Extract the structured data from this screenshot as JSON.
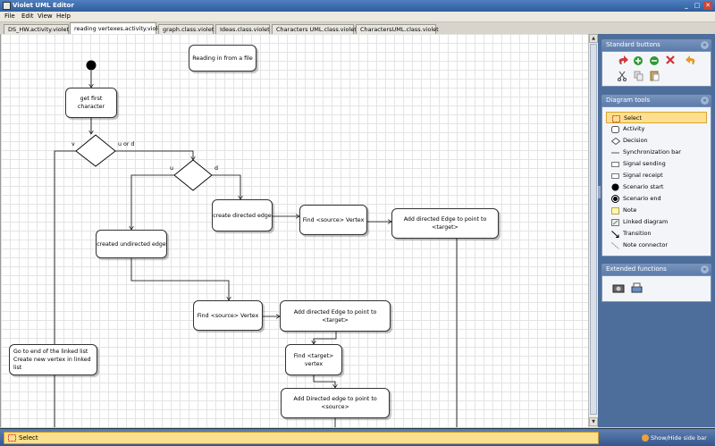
{
  "window": {
    "title": "Violet UML Editor",
    "controls": [
      "_",
      "□",
      "✕"
    ]
  },
  "menu": [
    "File",
    "Edit",
    "View",
    "Help"
  ],
  "tabs": [
    {
      "label": "DS_HW.activity.violet",
      "active": false
    },
    {
      "label": "reading vertexes.activity.violet",
      "active": true
    },
    {
      "label": "graph.class.violet",
      "active": false
    },
    {
      "label": "Ideas.class.violet",
      "active": false
    },
    {
      "label": "Characters UML.class.violet",
      "active": false
    },
    {
      "label": "CharactersUML.class.violet",
      "active": false
    }
  ],
  "diagram": {
    "nodes": [
      {
        "id": "n_reading",
        "text": "Reading in from a file"
      },
      {
        "id": "n_first",
        "text": "get first character"
      },
      {
        "id": "n_create_directed",
        "text": "create directed edge"
      },
      {
        "id": "n_find_src1",
        "text": "Find <source> Vertex"
      },
      {
        "id": "n_add_directed1",
        "text": "Add directed Edge to point to <target>"
      },
      {
        "id": "n_undirected",
        "text": "created undirected edge"
      },
      {
        "id": "n_find_src2",
        "text": "Find <source> Vertex"
      },
      {
        "id": "n_add_directed2",
        "text": "Add directed Edge to point to <target>"
      },
      {
        "id": "n_find_target",
        "text": "Find <target> vertex"
      },
      {
        "id": "n_add_directed3",
        "text": "Add Directed edge to point to <source>"
      },
      {
        "id": "n_goto_end",
        "text": "Go to end of the linked list\nCreate new vertex in linked list"
      }
    ],
    "edge_labels": {
      "v": "v",
      "u_or_d": "u or d",
      "u": "u",
      "d": "d"
    }
  },
  "sidebar": {
    "standard_buttons_title": "Standard buttons",
    "diagram_tools_title": "Diagram tools",
    "tools": [
      {
        "label": "Select",
        "icon": "select-icon",
        "selected": true
      },
      {
        "label": "Activity",
        "icon": "activity-icon",
        "selected": false
      },
      {
        "label": "Decision",
        "icon": "decision-icon",
        "selected": false
      },
      {
        "label": "Synchronization bar",
        "icon": "sync-bar-icon",
        "selected": false
      },
      {
        "label": "Signal sending",
        "icon": "signal-sending-icon",
        "selected": false
      },
      {
        "label": "Signal receipt",
        "icon": "signal-receipt-icon",
        "selected": false
      },
      {
        "label": "Scenario start",
        "icon": "scenario-start-icon",
        "selected": false
      },
      {
        "label": "Scenario end",
        "icon": "scenario-end-icon",
        "selected": false
      },
      {
        "label": "Note",
        "icon": "note-icon",
        "selected": false
      },
      {
        "label": "Linked diagram",
        "icon": "linked-diagram-icon",
        "selected": false
      },
      {
        "label": "Transition",
        "icon": "transition-icon",
        "selected": false
      },
      {
        "label": "Note connector",
        "icon": "note-connector-icon",
        "selected": false
      }
    ],
    "extended_functions_title": "Extended functions"
  },
  "status": {
    "current_tool": "Select",
    "toggle_sidebar": "Show/Hide side bar"
  },
  "colors": {
    "sidebar": "#4d6e9a",
    "status_highlight": "#fae08c",
    "title_bar": "#2f5d9b"
  }
}
